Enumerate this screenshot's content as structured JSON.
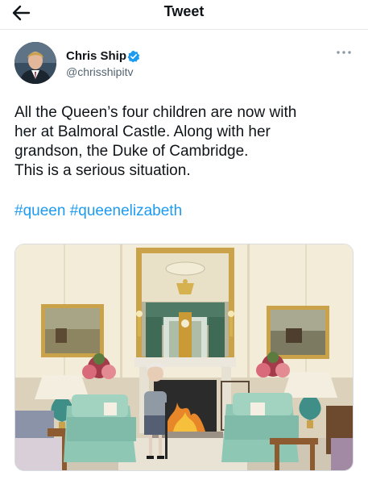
{
  "header": {
    "title": "Tweet",
    "back_icon": "arrow-left-icon"
  },
  "author": {
    "name": "Chris Ship",
    "handle": "@chrisshipitv",
    "verified_icon": "verified-badge-icon",
    "more_icon": "more-dots-icon"
  },
  "tweet": {
    "lines": [
      "All the Queen’s four children are now with",
      "her at Balmoral Castle. Along with her",
      "grandson, the Duke of Cambridge.",
      "This is a serious situation."
    ],
    "hashtags": [
      "#queen",
      "#queenelizabeth"
    ]
  },
  "colors": {
    "accent": "#1d9bf0",
    "text": "#0f1419",
    "secondary": "#536471"
  }
}
